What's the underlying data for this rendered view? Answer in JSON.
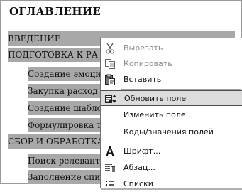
{
  "document": {
    "heading": "ОГЛАВЛЕНИЕ",
    "toc": [
      {
        "text": "ВВЕДЕНИЕ"
      },
      {
        "text": "ПОДГОТОВКА К РА"
      },
      {
        "text": "Создание эмоци"
      },
      {
        "text": "Закупка расход"
      },
      {
        "text": "Создание шабло"
      },
      {
        "text": "Формулировка т"
      },
      {
        "text": "СБОР И ОБРАБОТКА"
      },
      {
        "text": "Поиск релевант"
      },
      {
        "text": "Заполнение спис"
      }
    ]
  },
  "context_menu": {
    "items": [
      {
        "label": "Вырезать",
        "icon": "scissors-icon",
        "enabled": false
      },
      {
        "label": "Копировать",
        "icon": "copy-icon",
        "enabled": false
      },
      {
        "label": "Вставить",
        "icon": "paste-icon",
        "enabled": true
      },
      {
        "label": "Обновить поле",
        "icon": "update-field-icon",
        "enabled": true,
        "highlighted": true
      },
      {
        "label": "Изменить поле...",
        "icon": "",
        "enabled": true
      },
      {
        "label": "Коды/значения полей",
        "icon": "",
        "enabled": true
      },
      {
        "label": "Шрифт...",
        "icon": "font-icon",
        "enabled": true
      },
      {
        "label": "Абзац...",
        "icon": "paragraph-icon",
        "enabled": true
      },
      {
        "label": "Списки",
        "icon": "list-icon",
        "enabled": true
      }
    ]
  }
}
